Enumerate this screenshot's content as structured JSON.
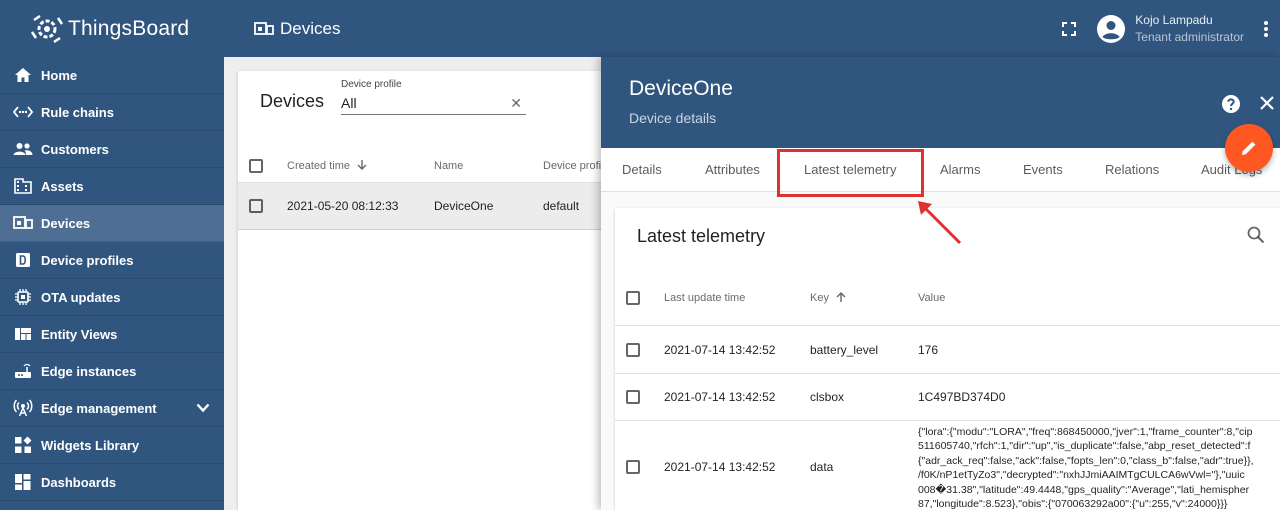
{
  "app": {
    "name": "ThingsBoard",
    "section": "Devices"
  },
  "user": {
    "name": "Kojo Lampadu",
    "role": "Tenant administrator"
  },
  "sidebar": {
    "items": [
      {
        "label": "Home",
        "icon": "home-icon"
      },
      {
        "label": "Rule chains",
        "icon": "code-arrows-icon"
      },
      {
        "label": "Customers",
        "icon": "people-icon"
      },
      {
        "label": "Assets",
        "icon": "building-icon"
      },
      {
        "label": "Devices",
        "icon": "device-icon",
        "active": true
      },
      {
        "label": "Device profiles",
        "icon": "device-profile-icon"
      },
      {
        "label": "OTA updates",
        "icon": "chip-icon"
      },
      {
        "label": "Entity Views",
        "icon": "view-quilt-icon"
      },
      {
        "label": "Edge instances",
        "icon": "router-icon"
      },
      {
        "label": "Edge management",
        "icon": "antenna-icon",
        "expandable": true
      },
      {
        "label": "Widgets Library",
        "icon": "widgets-icon"
      },
      {
        "label": "Dashboards",
        "icon": "dashboard-icon"
      }
    ]
  },
  "devices_card": {
    "title": "Devices",
    "filter": {
      "label": "Device profile",
      "value": "All"
    },
    "columns": [
      "Created time",
      "Name",
      "Device profi"
    ],
    "rows": [
      {
        "created": "2021-05-20 08:12:33",
        "name": "DeviceOne",
        "profile": "default"
      }
    ]
  },
  "detail": {
    "title": "DeviceOne",
    "subtitle": "Device details",
    "tabs": [
      "Details",
      "Attributes",
      "Latest telemetry",
      "Alarms",
      "Events",
      "Relations",
      "Audit Logs"
    ],
    "active_tab": "Latest telemetry",
    "highlight_color": "#e03131"
  },
  "telemetry": {
    "title": "Latest telemetry",
    "columns": [
      "Last update time",
      "Key",
      "Value"
    ],
    "rows": [
      {
        "time": "2021-07-14 13:42:52",
        "key": "battery_level",
        "value": "176"
      },
      {
        "time": "2021-07-14 13:42:52",
        "key": "clsbox",
        "value": "1C497BD374D0"
      },
      {
        "time": "2021-07-14 13:42:52",
        "key": "data",
        "value_lines": [
          "{\"lora\":{\"modu\":\"LORA\",\"freq\":868450000,\"jver\":1,\"frame_counter\":8,\"cip",
          "511605740,\"rfch\":1,\"dir\":\"up\",\"is_duplicate\":false,\"abp_reset_detected\":f",
          "{\"adr_ack_req\":false,\"ack\":false,\"fopts_len\":0,\"class_b\":false,\"adr\":true}},",
          "/f0K/nP1etTyZo3\",\"decrypted\":\"nxhJJmiAAIMTgCULCA6wVwl=\"},\"uuic",
          "008�31.38\",\"latitude\":49.4448,\"gps_quality\":\"Average\",\"lati_hemispher",
          "87,\"longitude\":8.523},\"obis\":{\"070063292a00\":{\"u\":255,\"v\":24000}}}"
        ]
      }
    ]
  },
  "colors": {
    "primary": "#305680",
    "accent": "#ff5722"
  }
}
